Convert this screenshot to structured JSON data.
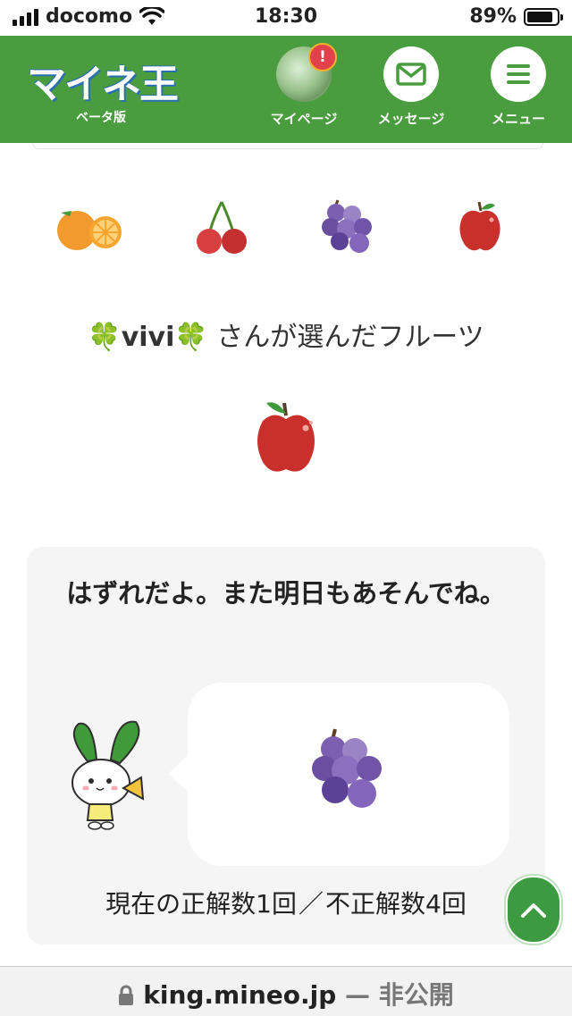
{
  "status_bar": {
    "carrier": "docomo",
    "time": "18:30",
    "battery": "89%",
    "battery_level": 0.89
  },
  "header": {
    "logo_text": "マイネ王",
    "logo_sub": "ベータ版",
    "mypage_label": "マイページ",
    "message_label": "メッセージ",
    "menu_label": "メニュー",
    "alert_mark": "!",
    "brand_color": "#4a9d3f"
  },
  "fruits": {
    "options": [
      "orange-icon",
      "cherry-icon",
      "grape-icon",
      "apple-icon"
    ]
  },
  "choice": {
    "clover": "🍀",
    "user_name": "vivi",
    "suffix": " さんが選んだフルーツ",
    "selected_fruit": "apple-icon"
  },
  "result": {
    "message": "はずれだよ。また明日もあそんでね。",
    "answer_fruit": "grape-icon",
    "score_correct": "現在の正解数1回",
    "score_separator": "／",
    "score_incorrect": "不正解数4回"
  },
  "url_bar": {
    "domain": "king.mineo.jp",
    "suffix": " — 非公開"
  }
}
